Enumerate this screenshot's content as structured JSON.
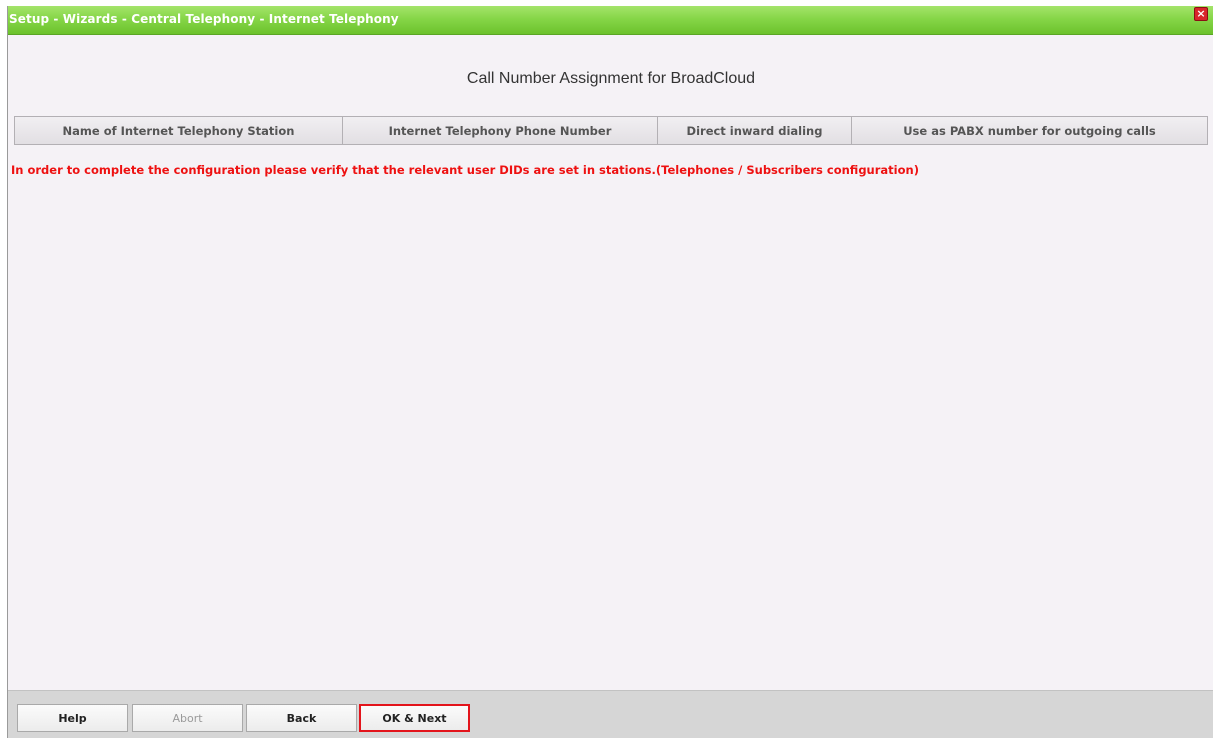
{
  "window": {
    "title": "Setup - Wizards - Central Telephony - Internet Telephony",
    "close_glyph": "×"
  },
  "heading": "Call Number Assignment for BroadCloud",
  "table": {
    "columns": [
      "Name of Internet Telephony Station",
      "Internet Telephony Phone Number",
      "Direct inward dialing",
      "Use as PABX number for outgoing calls"
    ]
  },
  "warning": "In order to complete the configuration please verify that the relevant user DIDs are set in stations.(Telephones / Subscribers configuration)",
  "footer": {
    "help_label": "Help",
    "abort_label": "Abort",
    "back_label": "Back",
    "ok_next_label": "OK & Next"
  },
  "colors": {
    "titlebar": "#86d648",
    "warning": "#ee1111",
    "primary_outline": "#e3141b"
  }
}
